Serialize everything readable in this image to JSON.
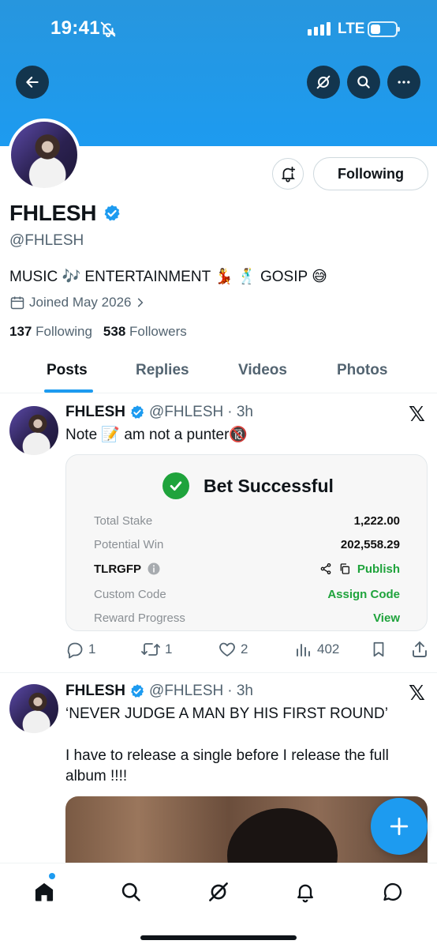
{
  "status_bar": {
    "time": "19:41",
    "network": "LTE"
  },
  "profile": {
    "name": "FHLESH",
    "handle": "@FHLESH",
    "bio": "MUSIC 🎶 ENTERTAINMENT 💃 🕺 GOSIP 😅",
    "joined": "Joined May 2026",
    "following_count": "137",
    "following_label": "Following",
    "followers_count": "538",
    "followers_label": "Followers",
    "follow_button": "Following"
  },
  "tabs": [
    {
      "label": "Posts",
      "active": true
    },
    {
      "label": "Replies",
      "active": false
    },
    {
      "label": "Videos",
      "active": false
    },
    {
      "label": "Photos",
      "active": false
    }
  ],
  "posts": [
    {
      "author": "FHLESH",
      "handle": "@FHLESH",
      "time": "· 3h",
      "text": "Note 📝 am not a punter🔞",
      "card": {
        "title": "Bet Successful",
        "rows": [
          {
            "label": "Total Stake",
            "value": "1,222.00"
          },
          {
            "label": "Potential Win",
            "value": "202,558.29"
          },
          {
            "label": "TLRGFP",
            "value": "Publish"
          },
          {
            "label": "Custom Code",
            "value": "Assign Code"
          },
          {
            "label": "Reward Progress",
            "value": "View"
          }
        ]
      },
      "replies": "1",
      "reposts": "1",
      "likes": "2",
      "views": "402"
    },
    {
      "author": "FHLESH",
      "handle": "@FHLESH",
      "time": "· 3h",
      "text_line1": "‘NEVER JUDGE A MAN BY HIS FIRST ROUND’",
      "text_line2": "I have to release a single before I release the full album !!!!"
    }
  ],
  "colors": {
    "accent": "#1d9bf0",
    "success": "#1fa33c",
    "muted": "#536471"
  }
}
